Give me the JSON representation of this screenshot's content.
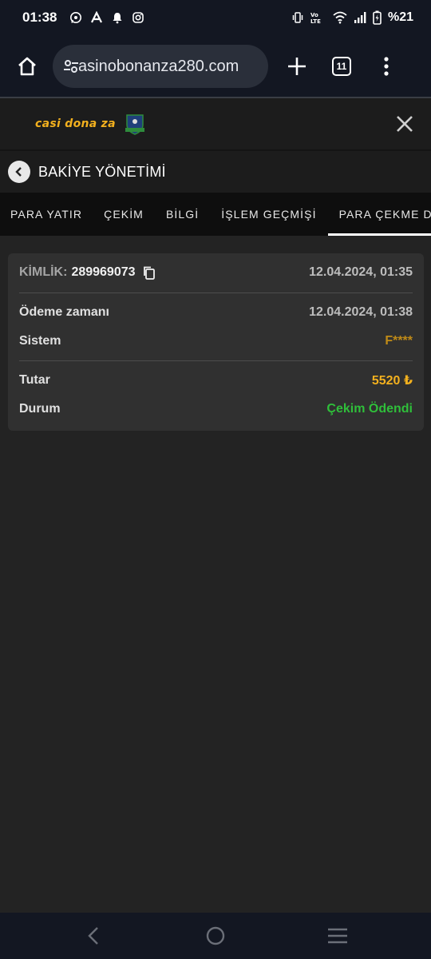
{
  "status_bar": {
    "time": "01:38",
    "battery": "%21",
    "left_icons": [
      "whatsapp-icon",
      "app-a-icon",
      "notification-bell-icon",
      "instagram-icon"
    ],
    "right_icons": [
      "vibrate-icon",
      "volte-icon",
      "wifi-icon",
      "signal-icon",
      "battery-charging-icon"
    ]
  },
  "browser": {
    "url": "asinobonanza280.com",
    "tab_count": "11"
  },
  "site": {
    "logo_text": "casi  dona  za"
  },
  "page": {
    "title": "BAKİYE YÖNETİMİ"
  },
  "tabs": [
    {
      "label": "PARA YATIR"
    },
    {
      "label": "ÇEKİM"
    },
    {
      "label": "BİLGİ"
    },
    {
      "label": "İŞLEM GEÇMİŞİ"
    },
    {
      "label": "PARA ÇEKME DURUMU"
    }
  ],
  "transaction": {
    "id_label": "KİMLİK:",
    "id_value": "289969073",
    "created": "12.04.2024, 01:35",
    "payment_time_label": "Ödeme zamanı",
    "payment_time": "12.04.2024, 01:38",
    "system_label": "Sistem",
    "system_value": "F****",
    "amount_label": "Tutar",
    "amount_value": "5520 ₺",
    "status_label": "Durum",
    "status_value": "Çekim Ödendi"
  },
  "colors": {
    "accent_gold": "#f2b01e",
    "status_green": "#2fbf3a",
    "background": "#232323",
    "card": "#303030"
  }
}
